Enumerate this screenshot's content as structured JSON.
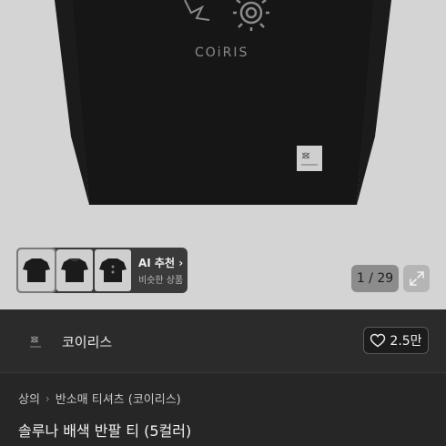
{
  "product_image": {
    "brand_print": "COiRIS"
  },
  "thumbnails": {
    "items": [
      "front",
      "back",
      "detail"
    ],
    "ai_title": "AI 추천",
    "ai_chevron": "›",
    "ai_subtitle": "비슷한 상품"
  },
  "gallery": {
    "counter": "1 / 29",
    "expand_icon": "expand-icon"
  },
  "seller": {
    "name": "코이리스",
    "likes": "2.5만",
    "like_icon": "heart-outline-icon"
  },
  "breadcrumb": {
    "items": [
      "상의",
      "반소매 티셔츠 (코이리스)"
    ],
    "separator": "›"
  },
  "product": {
    "title": "솔루나 배색 반팔 티 (5컬러)"
  }
}
